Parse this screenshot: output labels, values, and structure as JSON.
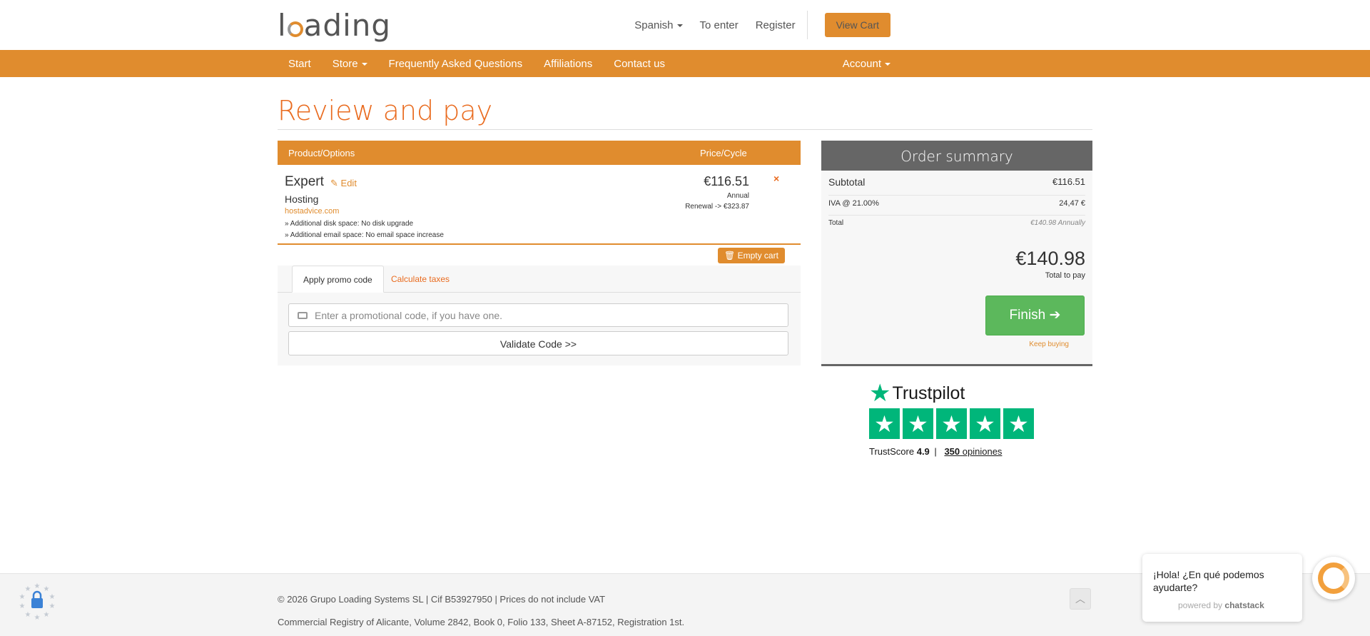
{
  "header": {
    "logo_text_a": "l",
    "logo_text_b": "ading",
    "language": "Spanish",
    "login": "To enter",
    "register": "Register",
    "view_cart": "View Cart"
  },
  "nav": {
    "start": "Start",
    "store": "Store",
    "faq": "Frequently Asked Questions",
    "affiliations": "Affiliations",
    "contact": "Contact us",
    "account": "Account"
  },
  "page_title": "Review and pay",
  "cart": {
    "col_product": "Product/Options",
    "col_price": "Price/Cycle",
    "item": {
      "name": "Expert",
      "edit": "Edit",
      "group": "Hosting",
      "domain": "hostadvice.com",
      "option1": "» Additional disk space: No disk upgrade",
      "option2": "» Additional email space: No email space increase",
      "price": "€116.51",
      "cycle": "Annual",
      "renewal": "Renewal -> €323.87",
      "remove": "×"
    },
    "empty_cart": "Empty cart"
  },
  "tabs": {
    "promo": "Apply promo code",
    "taxes": "Calculate taxes",
    "promo_placeholder": "Enter a promotional code, if you have one.",
    "validate": "Validate Code >>"
  },
  "summary": {
    "title": "Order summary",
    "subtotal_label": "Subtotal",
    "subtotal_value": "€116.51",
    "tax_label": "IVA @ 21.00%",
    "tax_value": "24,47 €",
    "total_label": "Total",
    "total_value": "€140.98 Annually",
    "total_due": "€140.98",
    "total_due_label": "Total to pay",
    "finish": "Finish",
    "keep_buying": "Keep buying"
  },
  "trustpilot": {
    "brand": "Trustpilot",
    "score_label": "TrustScore",
    "score": "4.9",
    "separator": "|",
    "reviews_count": "350",
    "reviews_label": "opiniones",
    "rating_stars": 5
  },
  "footer": {
    "line1": "© 2026 Grupo Loading Systems SL | Cif B53927950 | Prices do not include VAT",
    "line2": "Commercial Registry of Alicante, Volume 2842, Book 0, Folio 133, Sheet A-87152, Registration 1st."
  },
  "chat": {
    "message": "¡Hola! ¿En qué podemos ayudarte?",
    "powered_by": "powered by",
    "powered_brand": "chatstack"
  },
  "colors": {
    "brand_orange": "#e08c2e",
    "title_orange": "#e96b1f",
    "finish_green": "#5cb85c",
    "trustpilot_green": "#00b67a"
  }
}
